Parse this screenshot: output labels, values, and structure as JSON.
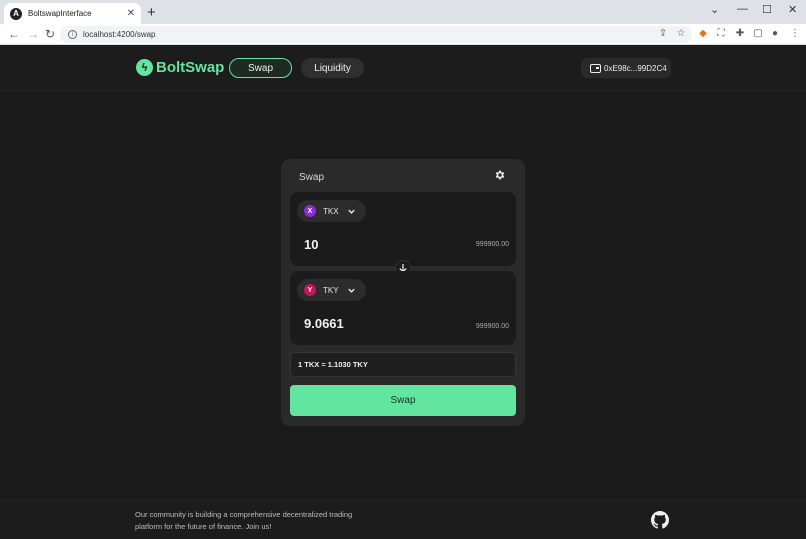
{
  "browser": {
    "tab_title": "BoltswapInterface",
    "tab_close": "✕",
    "new_tab": "+",
    "url": "localhost:4200/swap"
  },
  "header": {
    "logo_text": "BoltSwap",
    "nav": {
      "swap": "Swap",
      "liquidity": "Liquidity"
    },
    "wallet_address": "0xE98c...99D2C4"
  },
  "swap_card": {
    "title": "Swap",
    "from": {
      "symbol": "TKX",
      "icon_letter": "X",
      "icon_color": "#8a2be2",
      "amount": "10",
      "balance": "999900.00"
    },
    "to": {
      "symbol": "TKY",
      "icon_letter": "Y",
      "icon_color": "#c2185b",
      "amount": "9.0661",
      "balance": "999900.00"
    },
    "rate": "1 TKX = 1.1030 TKY",
    "swap_button": "Swap"
  },
  "footer": {
    "text": "Our community is building a comprehensive decentralized trading platform for the future of finance. Join us!"
  },
  "colors": {
    "accent": "#62e59e",
    "background": "#1b1b1b",
    "card": "#2a2a2a"
  }
}
